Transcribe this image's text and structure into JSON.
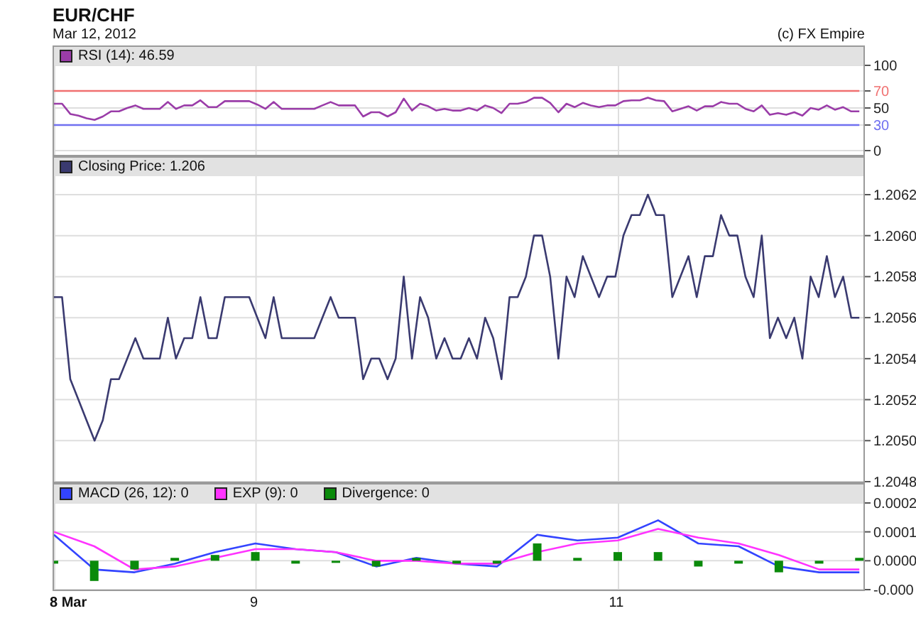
{
  "title": "EUR/CHF",
  "date": "Mar 12, 2012",
  "copyright": "(c) FX Empire",
  "panels": [
    {
      "chart_data": {
        "type": "line",
        "categories": [
          null,
          null,
          null,
          null,
          null,
          null,
          null,
          null,
          null,
          null,
          null,
          null,
          null,
          null,
          null,
          null,
          null,
          null,
          null,
          null,
          null,
          null,
          null,
          null,
          null,
          null,
          null,
          null,
          null,
          null,
          null,
          null,
          null,
          null,
          null,
          null,
          null,
          null,
          null,
          null,
          null,
          null,
          null,
          null,
          null,
          null,
          null,
          null,
          null,
          null,
          null,
          null,
          null,
          null,
          null,
          null,
          null,
          null,
          null,
          null,
          null,
          null,
          null,
          null,
          null,
          null,
          null,
          null,
          null,
          null,
          null,
          null,
          null,
          null,
          null,
          null,
          null,
          null,
          null,
          null,
          null,
          null,
          null,
          null,
          null,
          null,
          null,
          null,
          null,
          null,
          null,
          null,
          null,
          null,
          null,
          null,
          null,
          null,
          null,
          null
        ],
        "ylim": [
          -5,
          100
        ],
        "yticks": [
          0,
          30,
          50,
          70,
          100
        ],
        "grid": true,
        "legend": "top",
        "series": [
          {
            "name": "RSI (14): 46.59",
            "color": "#9a3ca8",
            "values": [
              55,
              55,
              43,
              41,
              38,
              36,
              40,
              46,
              46,
              50,
              53,
              49,
              49,
              49,
              57,
              49,
              53,
              53,
              59,
              51,
              51,
              58,
              58,
              58,
              58,
              54,
              49,
              57,
              49,
              49,
              49,
              49,
              49,
              53,
              57,
              53,
              53,
              53,
              40,
              45,
              45,
              40,
              45,
              61,
              47,
              55,
              52,
              47,
              49,
              47,
              47,
              50,
              47,
              53,
              50,
              44,
              55,
              55,
              57,
              62,
              62,
              56,
              45,
              55,
              51,
              56,
              53,
              51,
              53,
              53,
              58,
              59,
              59,
              62,
              59,
              58,
              46,
              49,
              52,
              47,
              52,
              52,
              57,
              55,
              55,
              49,
              46,
              53,
              42,
              44,
              42,
              45,
              41,
              50,
              48,
              53,
              48,
              51,
              46,
              46
            ]
          },
          {
            "color": "#f07070",
            "values": [
              70,
              70,
              70,
              70,
              70,
              70,
              70,
              70,
              70,
              70,
              70,
              70,
              70,
              70,
              70,
              70,
              70,
              70,
              70,
              70,
              70,
              70,
              70,
              70,
              70,
              70,
              70,
              70,
              70,
              70,
              70,
              70,
              70,
              70,
              70,
              70,
              70,
              70,
              70,
              70,
              70,
              70,
              70,
              70,
              70,
              70,
              70,
              70,
              70,
              70,
              70,
              70,
              70,
              70,
              70,
              70,
              70,
              70,
              70,
              70,
              70,
              70,
              70,
              70,
              70,
              70,
              70,
              70,
              70,
              70,
              70,
              70,
              70,
              70,
              70,
              70,
              70,
              70,
              70,
              70,
              70,
              70,
              70,
              70,
              70,
              70,
              70,
              70,
              70,
              70,
              70,
              70,
              70,
              70,
              70,
              70,
              70,
              70,
              70,
              70
            ]
          },
          {
            "color": "#7070f0",
            "values": [
              30,
              30,
              30,
              30,
              30,
              30,
              30,
              30,
              30,
              30,
              30,
              30,
              30,
              30,
              30,
              30,
              30,
              30,
              30,
              30,
              30,
              30,
              30,
              30,
              30,
              30,
              30,
              30,
              30,
              30,
              30,
              30,
              30,
              30,
              30,
              30,
              30,
              30,
              30,
              30,
              30,
              30,
              30,
              30,
              30,
              30,
              30,
              30,
              30,
              30,
              30,
              30,
              30,
              30,
              30,
              30,
              30,
              30,
              30,
              30,
              30,
              30,
              30,
              30,
              30,
              30,
              30,
              30,
              30,
              30,
              30,
              30,
              30,
              30,
              30,
              30,
              30,
              30,
              30,
              30,
              30,
              30,
              30,
              30,
              30,
              30,
              30,
              30,
              30,
              30,
              30,
              30,
              30,
              30,
              30,
              30,
              30,
              30,
              30,
              30
            ]
          }
        ]
      }
    },
    {
      "chart_data": {
        "type": "line",
        "categories": [
          null,
          null,
          null,
          null,
          null,
          null,
          null,
          null,
          null,
          null,
          null,
          null,
          null,
          null,
          null,
          null,
          null,
          null,
          null,
          null,
          null,
          null,
          null,
          null,
          null,
          null,
          null,
          null,
          null,
          null,
          null,
          null,
          null,
          null,
          null,
          null,
          null,
          null,
          null,
          null,
          null,
          null,
          null,
          null,
          null,
          null,
          null,
          null,
          null,
          null,
          null,
          null,
          null,
          null,
          null,
          null,
          null,
          null,
          null,
          null,
          null,
          null,
          null,
          null,
          null,
          null,
          null,
          null,
          null,
          null,
          null,
          null,
          null,
          null,
          null,
          null,
          null,
          null,
          null,
          null,
          null,
          null,
          null,
          null,
          null,
          null,
          null,
          null,
          null,
          null,
          null,
          null,
          null,
          null,
          null,
          null,
          null,
          null,
          null,
          null
        ],
        "ylim": [
          1.2048,
          1.20629
        ],
        "grid": true,
        "legend": "top",
        "yticks": [
          {
            "value": 1.2048,
            "label": "1.2048"
          },
          {
            "value": 1.205,
            "label": "1.2050"
          },
          {
            "value": 1.2052,
            "label": "1.2052"
          },
          {
            "value": 1.2054,
            "label": "1.2054"
          },
          {
            "value": 1.2056,
            "label": "1.2056"
          },
          {
            "value": 1.2058,
            "label": "1.2058"
          },
          {
            "value": 1.206,
            "label": "1.2060"
          },
          {
            "value": 1.2062,
            "label": "1.2062"
          }
        ],
        "series": [
          {
            "name": "Closing Price: 1.206",
            "color": "#3a3a70",
            "values": [
              1.2057,
              1.2057,
              1.2053,
              1.2052,
              1.2051,
              1.205,
              1.2051,
              1.2053,
              1.2053,
              1.2054,
              1.2055,
              1.2054,
              1.2054,
              1.2054,
              1.2056,
              1.2054,
              1.2055,
              1.2055,
              1.2057,
              1.2055,
              1.2055,
              1.2057,
              1.2057,
              1.2057,
              1.2057,
              1.2056,
              1.2055,
              1.2057,
              1.2055,
              1.2055,
              1.2055,
              1.2055,
              1.2055,
              1.2056,
              1.2057,
              1.2056,
              1.2056,
              1.2056,
              1.2053,
              1.2054,
              1.2054,
              1.2053,
              1.2054,
              1.2058,
              1.2054,
              1.2057,
              1.2056,
              1.2054,
              1.2055,
              1.2054,
              1.2054,
              1.2055,
              1.2054,
              1.2056,
              1.2055,
              1.2053,
              1.2057,
              1.2057,
              1.2058,
              1.206,
              1.206,
              1.2058,
              1.2054,
              1.2058,
              1.2057,
              1.2059,
              1.2058,
              1.2057,
              1.2058,
              1.2058,
              1.206,
              1.2061,
              1.2061,
              1.2062,
              1.2061,
              1.2061,
              1.2057,
              1.2058,
              1.2059,
              1.2057,
              1.2059,
              1.2059,
              1.2061,
              1.206,
              1.206,
              1.2058,
              1.2057,
              1.206,
              1.2055,
              1.2056,
              1.2055,
              1.2056,
              1.2054,
              1.2058,
              1.2057,
              1.2059,
              1.2057,
              1.2058,
              1.2056,
              1.2056
            ]
          }
        ]
      }
    },
    {
      "chart_data": {
        "type": "line",
        "categories": [
          "8 Mar",
          null,
          null,
          null,
          null,
          "9",
          null,
          null,
          null,
          null,
          null,
          null,
          null,
          null,
          "11",
          null,
          null,
          null,
          null,
          null,
          null
        ],
        "ylim": [
          -0.0001,
          0.0002
        ],
        "grid": true,
        "legend": "top",
        "yticks": [
          {
            "value": -0.0001,
            "label": "-0.000"
          },
          {
            "value": 0,
            "label": "0.0000"
          },
          {
            "value": 0.0001,
            "label": "0.0001"
          },
          {
            "value": 0.0002,
            "label": "0.0002"
          }
        ],
        "series": [
          {
            "name": "MACD (26, 12): 0",
            "color": "#3344ff",
            "type": "line",
            "values": [
              9e-05,
              -3e-05,
              -4e-05,
              -1e-05,
              3e-05,
              6e-05,
              4e-05,
              3e-05,
              -2e-05,
              1e-05,
              -1e-05,
              -2e-05,
              9e-05,
              7e-05,
              8e-05,
              0.00014,
              6e-05,
              5e-05,
              -2e-05,
              -4e-05,
              -4e-05
            ]
          },
          {
            "name": "EXP (9): 0",
            "color": "#ff33ff",
            "type": "line",
            "values": [
              0.0001,
              5e-05,
              -3e-05,
              -2e-05,
              1e-05,
              4e-05,
              4e-05,
              3e-05,
              0,
              0,
              -1e-05,
              -1e-05,
              3e-05,
              6e-05,
              7e-05,
              0.00011,
              8e-05,
              6e-05,
              2e-05,
              -3e-05,
              -3e-05
            ]
          },
          {
            "name": "Divergence: 0",
            "color": "#0a8a0a",
            "type": "bar",
            "values": [
              -1e-05,
              -7e-05,
              -3e-05,
              1e-05,
              2e-05,
              3e-05,
              -1e-05,
              0,
              -2e-05,
              1e-05,
              -1e-05,
              -1e-05,
              6e-05,
              1e-05,
              3e-05,
              3e-05,
              -2e-05,
              -1e-05,
              -4e-05,
              -1e-05,
              1e-05
            ]
          }
        ]
      }
    }
  ]
}
